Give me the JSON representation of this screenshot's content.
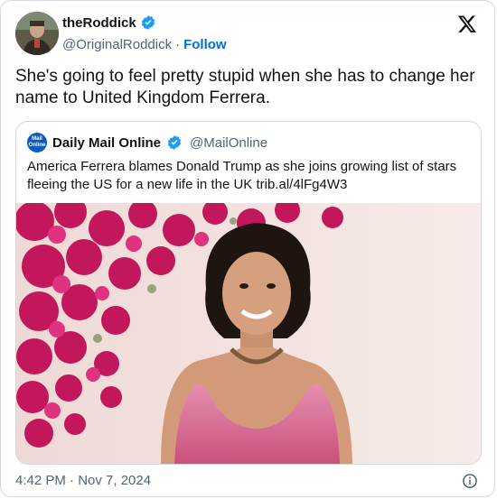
{
  "author": {
    "display_name": "theRoddick",
    "handle": "@OriginalRoddick",
    "separator": "·",
    "follow_label": "Follow",
    "verified_color": "#1d9bf0"
  },
  "tweet": {
    "text": "She's going to feel pretty stupid when she has to change her name to United Kingdom Ferrera."
  },
  "quoted": {
    "avatar_text_line1": "Mail",
    "avatar_text_line2": "Online",
    "display_name": "Daily Mail Online",
    "handle": "@MailOnline",
    "text": "America Ferrera blames Donald Trump as she joins growing list of stars fleeing the US for a new life in the UK trib.al/4lFg4W3",
    "image": "photo-woman-pink-dress-bougainvillea"
  },
  "footer": {
    "timestamp": "4:42 PM · Nov 7, 2024"
  },
  "icons": {
    "platform_logo": "x-logo-icon",
    "info": "info-icon"
  }
}
